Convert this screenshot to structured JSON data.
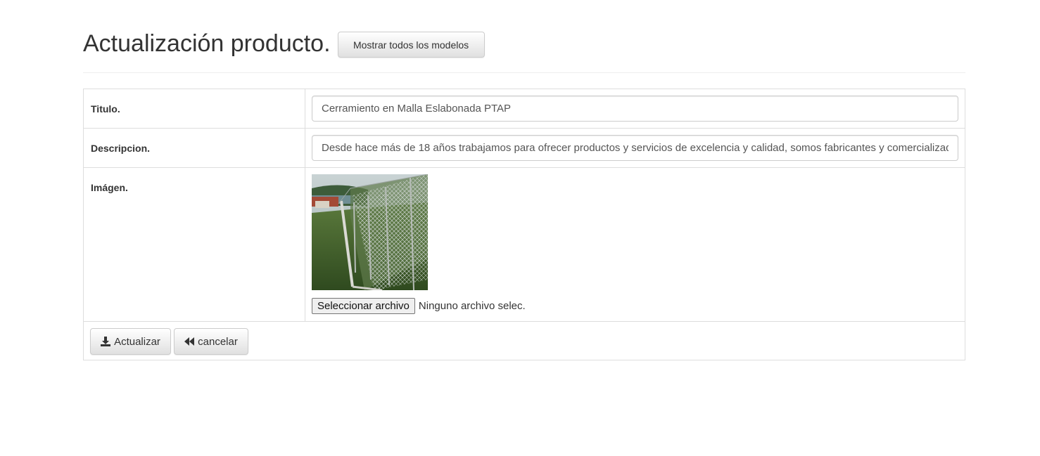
{
  "header": {
    "title": "Actualización producto.",
    "show_models_label": "Mostrar todos los modelos"
  },
  "form": {
    "title_label": "Titulo.",
    "title_value": "Cerramiento en Malla Eslabonada PTAP",
    "description_label": "Descripcion.",
    "description_value": "Desde hace más de 18 años trabajamos para ofrecer productos y servicios de excelencia y calidad, somos fabricantes y comercializadores",
    "image_label": "Imágen.",
    "file_button_label": "Seleccionar archivo",
    "file_status": "Ninguno archivo selec."
  },
  "actions": {
    "update_label": "Actualizar",
    "update_icon": "download-icon",
    "cancel_label": "cancelar",
    "cancel_icon": "backward-icon"
  },
  "colors": {
    "border": "#dddddd",
    "text": "#333333",
    "button_bg": "#e0e0e0"
  }
}
